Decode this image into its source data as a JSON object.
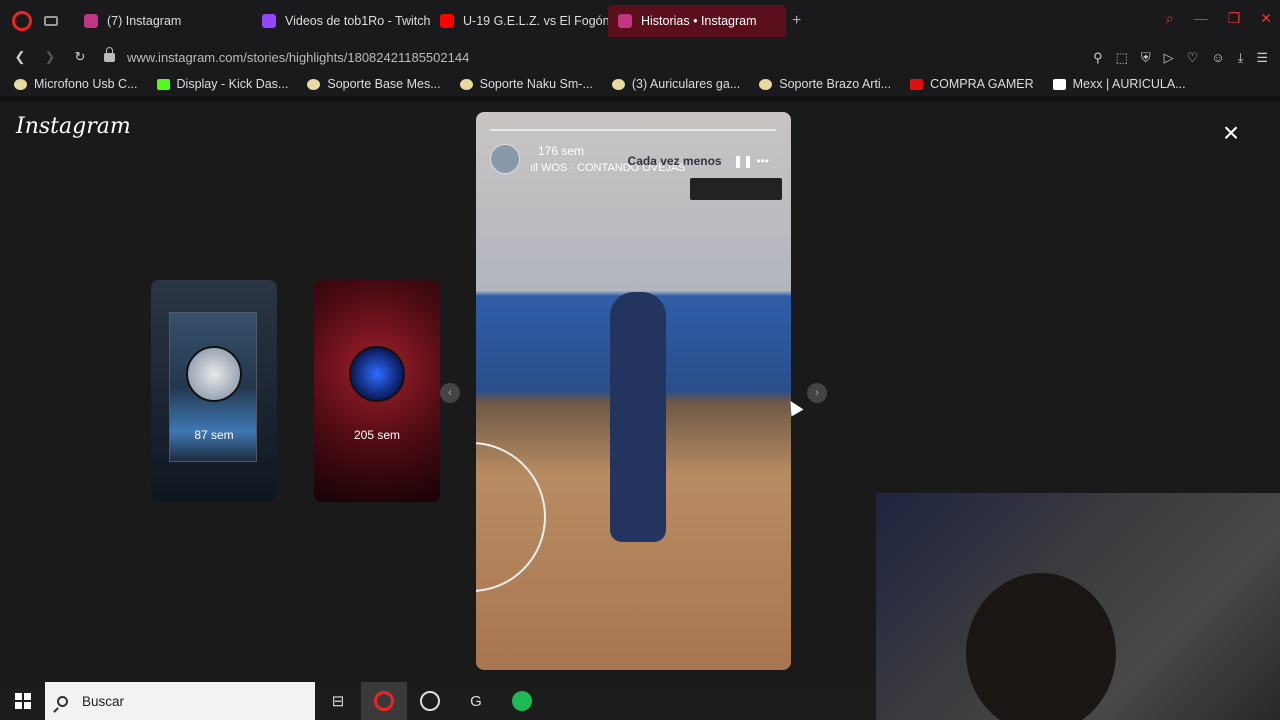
{
  "browser": {
    "tabs": [
      {
        "label": "(7) Instagram",
        "color": "#c13584",
        "active": false
      },
      {
        "label": "Videos de tob1Ro - Twitch",
        "color": "#9146ff",
        "active": false
      },
      {
        "label": "U-19 G.E.L.Z. vs El Fogón",
        "color": "#ff0000",
        "active": false
      },
      {
        "label": "Historias • Instagram",
        "color": "#c13584",
        "active": true
      }
    ],
    "new_tab": "+",
    "url": "www.instagram.com/stories/highlights/18082421185502144"
  },
  "bookmarks": [
    {
      "label": "Microfono Usb C...",
      "color": "#e8d9a0"
    },
    {
      "label": "Display - Kick Das...",
      "color": "#53fc18"
    },
    {
      "label": "Soporte Base Mes...",
      "color": "#e8d9a0"
    },
    {
      "label": "Soporte Naku Sm-...",
      "color": "#e8d9a0"
    },
    {
      "label": "(3) Auriculares ga...",
      "color": "#e8d9a0"
    },
    {
      "label": "Soporte Brazo Arti...",
      "color": "#e8d9a0"
    },
    {
      "label": "COMPRA GAMER",
      "color": "#d11"
    },
    {
      "label": "Mexx | AURICULA...",
      "color": "#fff"
    }
  ],
  "instagram": {
    "logo": "Instagram",
    "close": "×",
    "cards": [
      {
        "label": "87 sem"
      },
      {
        "label": "205 sem"
      }
    ],
    "story": {
      "time": "176 sem",
      "music": "WOS · CONTANDO OVEJAS",
      "overlay": "Cada vez menos"
    }
  },
  "taskbar": {
    "search_placeholder": "Buscar"
  },
  "icons": {
    "prev_arrow": "‹",
    "next_arrow": "›"
  }
}
